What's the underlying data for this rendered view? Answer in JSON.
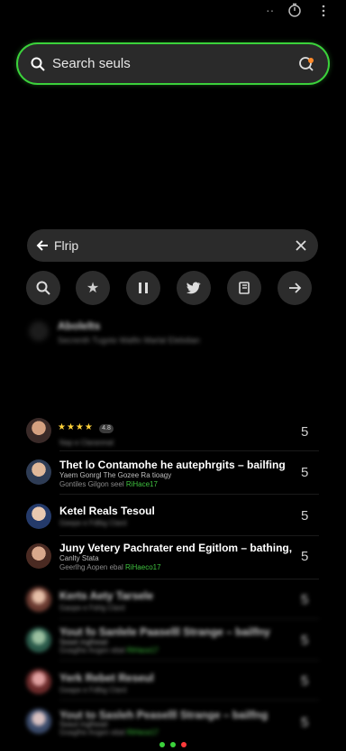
{
  "topbar": {
    "more_icon": "more-vertical-icon",
    "timer_icon": "timer-icon",
    "dots_icon": "dots-icon"
  },
  "search_main": {
    "placeholder": "Search seuls"
  },
  "search_sub": {
    "value": "Flrip"
  },
  "filters": [
    {
      "name": "search-filter-icon"
    },
    {
      "name": "star-filter-icon"
    },
    {
      "name": "pause-filter-icon"
    },
    {
      "name": "twitter-filter-icon"
    },
    {
      "name": "book-filter-icon"
    },
    {
      "name": "share-filter-icon"
    }
  ],
  "overlay": {
    "title": "Abolelts",
    "subtitle": "Secrenth Tugoto Walfin Marlal Elebdian"
  },
  "results": [
    {
      "rating_text": "★★★★",
      "badge": "4.8",
      "sub": "Nap e Claranmal",
      "count": "5"
    },
    {
      "title": "Thet lo Contamohe he autephrgits – bailfing",
      "line2": "Yaem Gonrgl The Gozee Ra tioagy",
      "sub": "Gontiles Gilgon seel",
      "tag": "RiHace17",
      "count": "5"
    },
    {
      "title": "Ketel Reals Tesoul",
      "sub": "Geepe e Fdlbg Clard",
      "count": "5"
    },
    {
      "title": "Juny Vetery Pachrater end Egitlom – bathing,",
      "line2": "Canlty Stata",
      "sub": "Geerlhg Aopen ebal",
      "tag": "RiHaeco17",
      "count": "5"
    },
    {
      "title": "Kerts Aety Tarsele",
      "sub": "Gaope e Fdrlg Clard",
      "count": "5"
    },
    {
      "title": "Yout fo Sanlele Paaselll Strange – bailfny",
      "line2": "Seaet inglhead",
      "sub": "Goaglhe Aogen ebal",
      "tag": "RiHace17",
      "count": "5"
    },
    {
      "title": "Yerk Rebet Reseul",
      "sub": "Geape e Fdlbg Clard",
      "count": "5"
    },
    {
      "title": "Yout to Sasleh Peaselll Strange – bailfng",
      "line2": "Seaut inglhead",
      "sub": "Goaglhe Aogen ebal",
      "tag": "RiHece17",
      "count": "5"
    }
  ],
  "colors": {
    "accent": "#3bd23b",
    "dots": [
      "#3bd23b",
      "#3bd23b",
      "#ff3b3b"
    ]
  }
}
